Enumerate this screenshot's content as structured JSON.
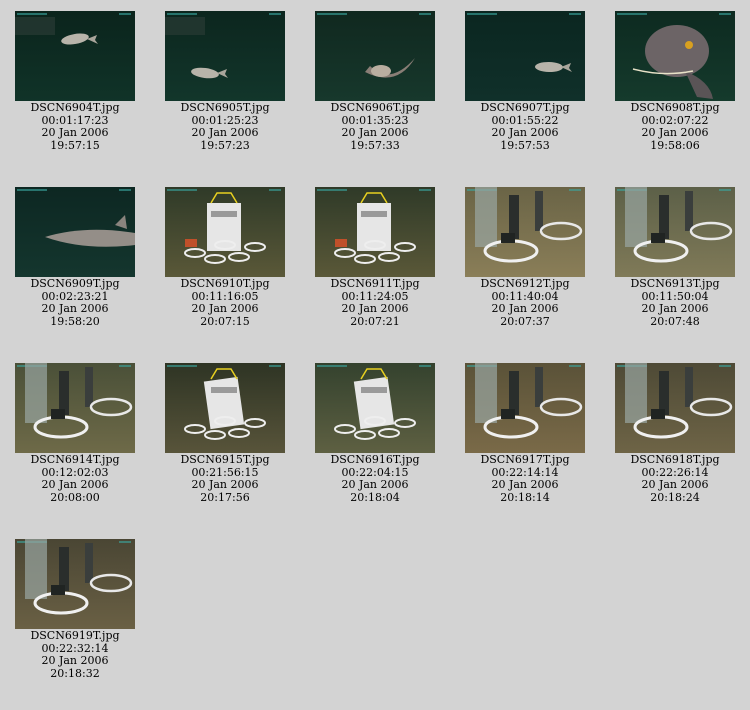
{
  "thumbnails": [
    {
      "file": "DSCN6904T.jpg",
      "elapsed": "00:01:17:23",
      "date": "20 Jan 2006",
      "time": "19:57:15",
      "scene": "fish-small",
      "colors": {
        "bg_top": "#0b241c",
        "bg_bottom": "#103328"
      }
    },
    {
      "file": "DSCN6905T.jpg",
      "elapsed": "00:01:25:23",
      "date": "20 Jan 2006",
      "time": "19:57:23",
      "scene": "fish-small",
      "colors": {
        "bg_top": "#0c261e",
        "bg_bottom": "#12362b"
      }
    },
    {
      "file": "DSCN6906T.jpg",
      "elapsed": "00:01:35:23",
      "date": "20 Jan 2006",
      "time": "19:57:33",
      "scene": "fish-mid",
      "colors": {
        "bg_top": "#10281f",
        "bg_bottom": "#17382c"
      }
    },
    {
      "file": "DSCN6907T.jpg",
      "elapsed": "00:01:55:22",
      "date": "20 Jan 2006",
      "time": "19:57:53",
      "scene": "fish-small",
      "colors": {
        "bg_top": "#0b2620",
        "bg_bottom": "#10302a"
      }
    },
    {
      "file": "DSCN6908T.jpg",
      "elapsed": "00:02:07:22",
      "date": "20 Jan 2006",
      "time": "19:58:06",
      "scene": "fish-large",
      "colors": {
        "bg_top": "#0d2a20",
        "bg_bottom": "#153a2c"
      }
    },
    {
      "file": "DSCN6909T.jpg",
      "elapsed": "00:02:23:21",
      "date": "20 Jan 2006",
      "time": "19:58:20",
      "scene": "fish-side",
      "colors": {
        "bg_top": "#0d2722",
        "bg_bottom": "#14362e"
      }
    },
    {
      "file": "DSCN6910T.jpg",
      "elapsed": "00:11:16:05",
      "date": "20 Jan 2006",
      "time": "20:07:15",
      "scene": "lander",
      "colors": {
        "bg_top": "#2f3a28",
        "bg_bottom": "#5a5838"
      }
    },
    {
      "file": "DSCN6911T.jpg",
      "elapsed": "00:11:24:05",
      "date": "20 Jan 2006",
      "time": "20:07:21",
      "scene": "lander",
      "colors": {
        "bg_top": "#2f3a28",
        "bg_bottom": "#5a5838"
      }
    },
    {
      "file": "DSCN6912T.jpg",
      "elapsed": "00:11:40:04",
      "date": "20 Jan 2006",
      "time": "20:07:37",
      "scene": "closeup",
      "colors": {
        "bg_top": "#6a6446",
        "bg_bottom": "#8a7e58"
      }
    },
    {
      "file": "DSCN6913T.jpg",
      "elapsed": "00:11:50:04",
      "date": "20 Jan 2006",
      "time": "20:07:48",
      "scene": "closeup",
      "colors": {
        "bg_top": "#5c6048",
        "bg_bottom": "#807a58"
      }
    },
    {
      "file": "DSCN6914T.jpg",
      "elapsed": "00:12:02:03",
      "date": "20 Jan 2006",
      "time": "20:08:00",
      "scene": "closeup",
      "colors": {
        "bg_top": "#4a5038",
        "bg_bottom": "#6e6a48"
      }
    },
    {
      "file": "DSCN6915T.jpg",
      "elapsed": "00:21:56:15",
      "date": "20 Jan 2006",
      "time": "20:17:56",
      "scene": "lander-tilt",
      "colors": {
        "bg_top": "#2e3424",
        "bg_bottom": "#58543a"
      }
    },
    {
      "file": "DSCN6916T.jpg",
      "elapsed": "00:22:04:15",
      "date": "20 Jan 2006",
      "time": "20:18:04",
      "scene": "lander-tilt",
      "colors": {
        "bg_top": "#34422e",
        "bg_bottom": "#5e6042"
      }
    },
    {
      "file": "DSCN6917T.jpg",
      "elapsed": "00:22:14:14",
      "date": "20 Jan 2006",
      "time": "20:18:14",
      "scene": "closeup",
      "colors": {
        "bg_top": "#5a5238",
        "bg_bottom": "#7a6a48"
      }
    },
    {
      "file": "DSCN6918T.jpg",
      "elapsed": "00:22:26:14",
      "date": "20 Jan 2006",
      "time": "20:18:24",
      "scene": "closeup",
      "colors": {
        "bg_top": "#4e4a36",
        "bg_bottom": "#6e6446"
      }
    },
    {
      "file": "DSCN6919T.jpg",
      "elapsed": "00:22:32:14",
      "date": "20 Jan 2006",
      "time": "20:18:32",
      "scene": "closeup",
      "colors": {
        "bg_top": "#4a4634",
        "bg_bottom": "#6a6044"
      }
    }
  ]
}
